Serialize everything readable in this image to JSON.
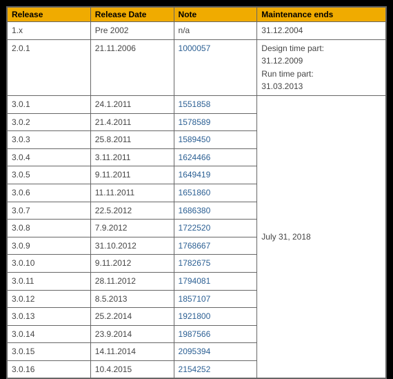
{
  "headers": {
    "release": "Release",
    "release_date": "Release Date",
    "note": "Note",
    "maintenance": "Maintenance ends"
  },
  "row1": {
    "release": "1.x",
    "date": "Pre 2002",
    "note": "n/a",
    "maint": "31.12.2004"
  },
  "row2": {
    "release": "2.0.1",
    "date": "21.11.2006",
    "note": "1000057",
    "maint_l1": "Design time part:",
    "maint_l2": "31.12.2009",
    "maint_l3": "Run time part:",
    "maint_l4": "31.03.2013"
  },
  "group3_maint": "July 31, 2018",
  "g3": [
    {
      "release": "3.0.1",
      "date": "24.1.2011",
      "note": "1551858"
    },
    {
      "release": "3.0.2",
      "date": "21.4.2011",
      "note": "1578589"
    },
    {
      "release": "3.0.3",
      "date": "25.8.2011",
      "note": "1589450"
    },
    {
      "release": "3.0.4",
      "date": "3.11.2011",
      "note": "1624466"
    },
    {
      "release": "3.0.5",
      "date": "9.11.2011",
      "note": "1649419"
    },
    {
      "release": "3.0.6",
      "date": "11.11.2011",
      "note": "1651860"
    },
    {
      "release": "3.0.7",
      "date": "22.5.2012",
      "note": "1686380"
    },
    {
      "release": "3.0.8",
      "date": "7.9.2012",
      "note": "1722520"
    },
    {
      "release": "3.0.9",
      "date": "31.10.2012",
      "note": "1768667"
    },
    {
      "release": "3.0.10",
      "date": "9.11.2012",
      "note": "1782675"
    },
    {
      "release": "3.0.11",
      "date": "28.11.2012",
      "note": "1794081"
    },
    {
      "release": "3.0.12",
      "date": "8.5.2013",
      "note": "1857107"
    },
    {
      "release": "3.0.13",
      "date": "25.2.2014",
      "note": "1921800"
    },
    {
      "release": "3.0.14",
      "date": "23.9.2014",
      "note": "1987566"
    },
    {
      "release": "3.0.15",
      "date": "14.11.2014",
      "note": "2095394"
    },
    {
      "release": "3.0.16",
      "date": "10.4.2015",
      "note": "2154252"
    }
  ]
}
